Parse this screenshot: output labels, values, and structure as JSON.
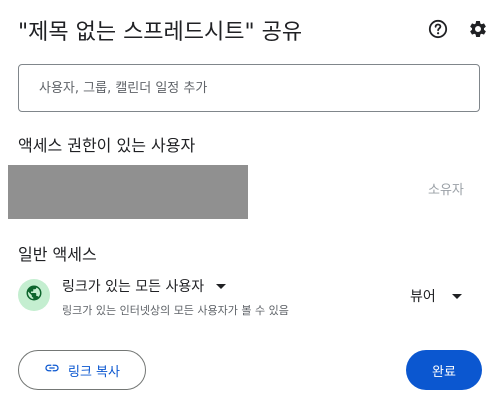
{
  "dialog": {
    "title": "\"제목 없는 스프레드시트\" 공유",
    "help_icon": "help-circle-icon",
    "settings_icon": "gear-icon"
  },
  "add_people": {
    "placeholder": "사용자, 그룹, 캘린더 일정 추가"
  },
  "people_with_access": {
    "heading": "액세스 권한이 있는 사용자",
    "owner": {
      "role": "소유자"
    }
  },
  "general_access": {
    "heading": "일반 액세스",
    "icon": "globe-icon",
    "icon_background": "#c4eed0",
    "selected_option": "링크가 있는 모든 사용자",
    "description": "링크가 있는 인터넷상의 모든 사용자가 볼 수 있음",
    "role": "뷰어"
  },
  "footer": {
    "copy_link_label": "링크 복사",
    "copy_link_icon": "link-icon",
    "done_label": "완료"
  },
  "colors": {
    "accent": "#0b57d0",
    "text": "#202124",
    "muted": "#5f6368"
  }
}
